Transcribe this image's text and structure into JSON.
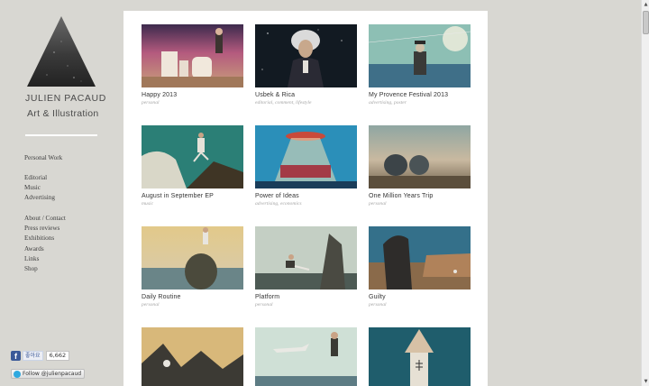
{
  "brand": {
    "name": "JULIEN PACAUD",
    "tagline": "Art & Illustration"
  },
  "nav_group_1": [
    {
      "label": "Personal Work"
    }
  ],
  "nav_group_2": [
    {
      "label": "Editorial"
    },
    {
      "label": "Music"
    },
    {
      "label": "Advertising"
    }
  ],
  "nav_group_3": [
    {
      "label": "About / Contact"
    },
    {
      "label": "Press reviews"
    },
    {
      "label": "Exhibitions"
    },
    {
      "label": "Awards"
    },
    {
      "label": "Links"
    },
    {
      "label": "Shop"
    }
  ],
  "social": {
    "facebook_icon": "f",
    "facebook_label": "좋아요",
    "facebook_count": "6,662",
    "twitter_label": "Follow @julienpacaud"
  },
  "portfolio": [
    {
      "title": "Happy 2013",
      "tags": "personal",
      "icon": "happy-2013-thumbnail"
    },
    {
      "title": "Usbek & Rica",
      "tags": "editorial, comment, lifestyle",
      "icon": "usbek-rica-thumbnail"
    },
    {
      "title": "My Provence Festival 2013",
      "tags": "advertising, poster",
      "icon": "provence-festival-thumbnail"
    },
    {
      "title": "August in September EP",
      "tags": "music",
      "icon": "august-september-thumbnail"
    },
    {
      "title": "Power of Ideas",
      "tags": "advertising, economics",
      "icon": "power-of-ideas-thumbnail"
    },
    {
      "title": "One Million Years Trip",
      "tags": "personal",
      "icon": "one-million-years-thumbnail"
    },
    {
      "title": "Daily Routine",
      "tags": "personal",
      "icon": "daily-routine-thumbnail"
    },
    {
      "title": "Platform",
      "tags": "personal",
      "icon": "platform-thumbnail"
    },
    {
      "title": "Guilty",
      "tags": "personal",
      "icon": "guilty-thumbnail"
    },
    {
      "title": "",
      "tags": "",
      "icon": "mountains-thumbnail"
    },
    {
      "title": "",
      "tags": "",
      "icon": "airplane-thumbnail"
    },
    {
      "title": "",
      "tags": "",
      "icon": "pyramid-head-thumbnail"
    }
  ],
  "colors": {
    "page_background": "#d8d7d2",
    "panel_background": "#ffffff",
    "text": "#333333",
    "tag_text": "#a5a5a5"
  }
}
